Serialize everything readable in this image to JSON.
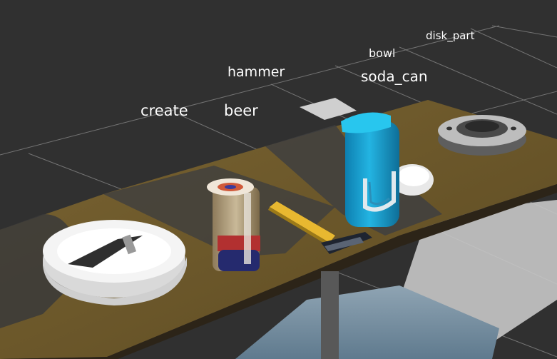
{
  "viewport": {
    "background_color": "#303030",
    "grid_color": "#8a8a8a",
    "table_color": "#6e5a2c"
  },
  "object_labels": {
    "create": "create",
    "beer": "beer",
    "hammer": "hammer",
    "soda_can": "soda_can",
    "bowl": "bowl",
    "disk_part": "disk_part"
  },
  "objects": [
    {
      "name": "create",
      "color": "#f2f2f2"
    },
    {
      "name": "beer",
      "color": "#2a2f7a"
    },
    {
      "name": "hammer",
      "color": "#e8b830"
    },
    {
      "name": "soda_can",
      "color": "#1aa3d4"
    },
    {
      "name": "bowl",
      "color": "#ffffff"
    },
    {
      "name": "disk_part",
      "color": "#9a9a9a"
    }
  ]
}
